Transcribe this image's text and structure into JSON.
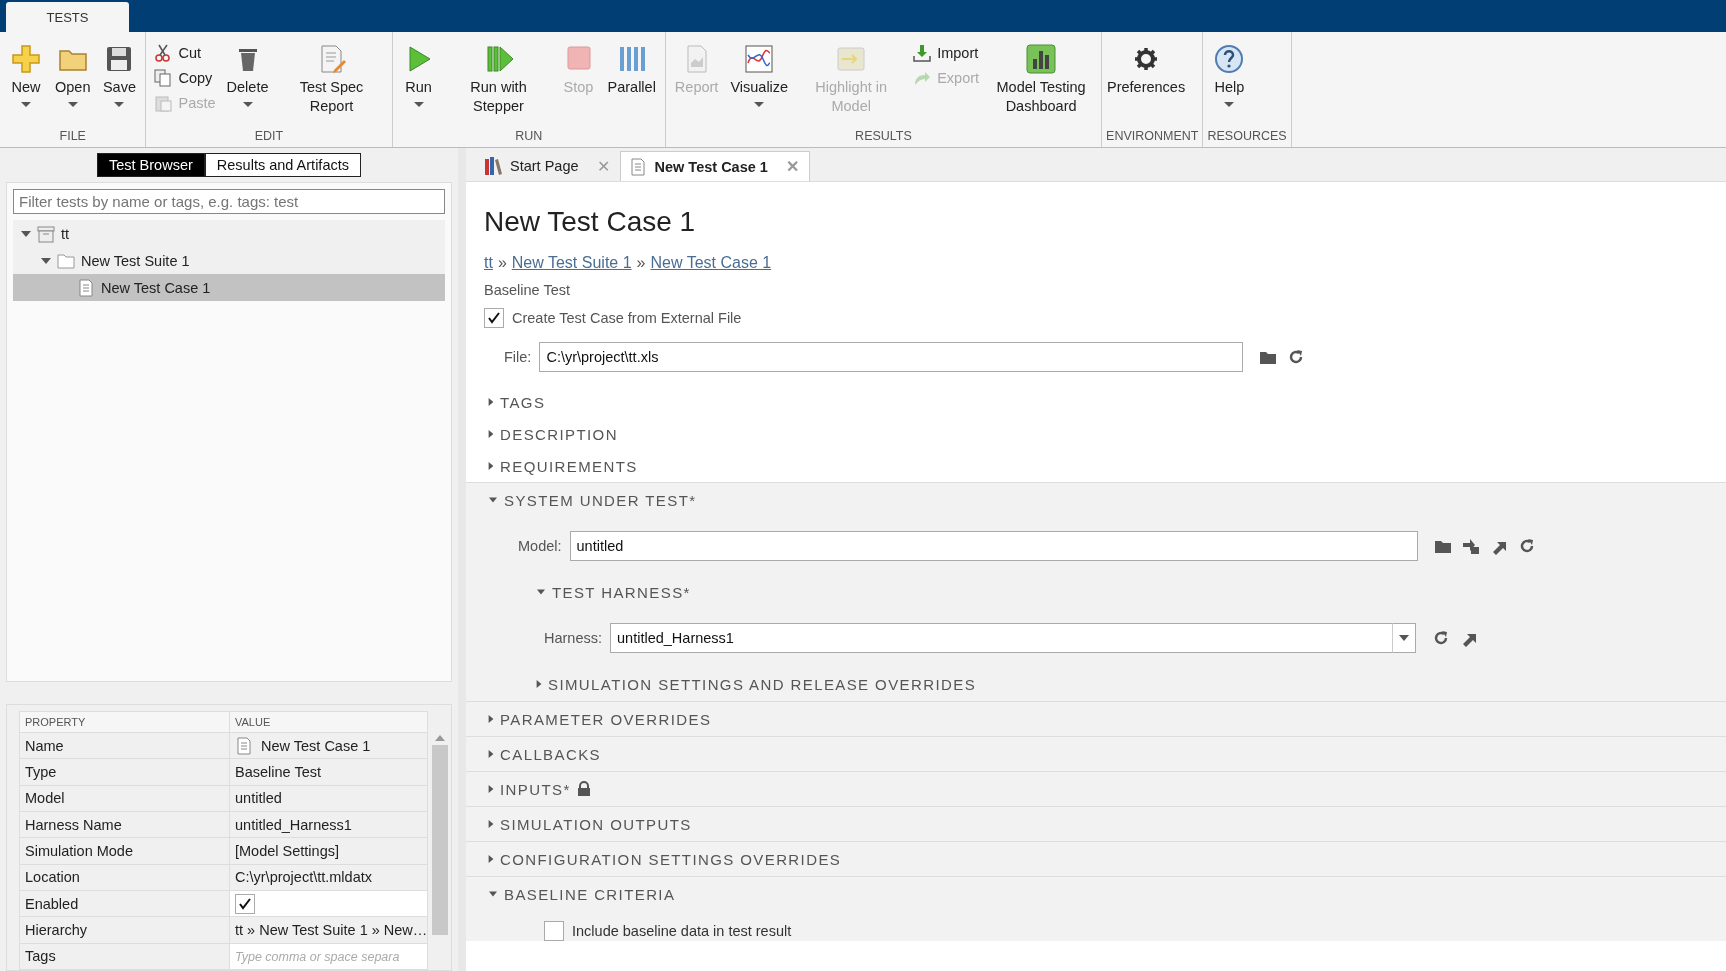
{
  "app_tab": {
    "label": "TESTS",
    "selected": true
  },
  "ribbon": [
    {
      "label": "FILE",
      "items": [
        {
          "kind": "large",
          "label": "New",
          "disabled": false,
          "dropdown": true
        },
        {
          "kind": "large",
          "label": "Open",
          "disabled": false,
          "dropdown": true
        },
        {
          "kind": "large",
          "label": "Save",
          "disabled": false,
          "dropdown": true
        }
      ]
    },
    {
      "label": "EDIT",
      "items": [
        {
          "kind": "stack",
          "items": [
            {
              "label": "Cut",
              "disabled": false
            },
            {
              "label": "Copy",
              "disabled": false
            },
            {
              "label": "Paste",
              "disabled": true
            }
          ]
        },
        {
          "kind": "large",
          "label": "Delete",
          "disabled": false,
          "dropdown": true
        },
        {
          "kind": "large",
          "label": "Test Spec Report",
          "disabled": false,
          "dropdown": false
        }
      ]
    },
    {
      "label": "RUN",
      "items": [
        {
          "kind": "large",
          "label": "Run",
          "disabled": false,
          "dropdown": true
        },
        {
          "kind": "large",
          "label": "Run with Stepper",
          "disabled": false,
          "dropdown": false
        },
        {
          "kind": "large",
          "label": "Stop",
          "disabled": true,
          "dropdown": false
        },
        {
          "kind": "large",
          "label": "Parallel",
          "disabled": false,
          "dropdown": false
        }
      ]
    },
    {
      "label": "RESULTS",
      "items": [
        {
          "kind": "large",
          "label": "Report",
          "disabled": true,
          "dropdown": false
        },
        {
          "kind": "large",
          "label": "Visualize",
          "disabled": false,
          "dropdown": true
        },
        {
          "kind": "large",
          "label": "Highlight in Model",
          "disabled": true,
          "dropdown": false
        },
        {
          "kind": "stack",
          "items": [
            {
              "label": "Import",
              "disabled": false
            },
            {
              "label": "Export",
              "disabled": true
            }
          ]
        },
        {
          "kind": "large",
          "label": "Model Testing Dashboard",
          "disabled": false,
          "dropdown": false
        }
      ]
    },
    {
      "label": "ENVIRONMENT",
      "items": [
        {
          "kind": "large",
          "label": "Preferences",
          "disabled": false,
          "dropdown": false
        }
      ]
    },
    {
      "label": "RESOURCES",
      "items": [
        {
          "kind": "large",
          "label": "Help",
          "disabled": false,
          "dropdown": true
        }
      ]
    }
  ],
  "browser_tabs": [
    {
      "label": "Test Browser",
      "selected": true
    },
    {
      "label": "Results and Artifacts",
      "selected": false
    }
  ],
  "filter": {
    "placeholder": "Filter tests by name or tags, e.g. tags: test"
  },
  "tree": [
    {
      "label": "tt",
      "kind": "file",
      "expanded": true,
      "selected": false,
      "children": [
        {
          "label": "New Test Suite 1",
          "kind": "suite",
          "expanded": true,
          "selected": false,
          "children": [
            {
              "label": "New Test Case 1",
              "kind": "case",
              "selected": true
            }
          ]
        }
      ]
    }
  ],
  "properties": {
    "columns": [
      "PROPERTY",
      "VALUE"
    ],
    "rows": [
      {
        "name": "Name",
        "value": "New Test Case 1",
        "kind": "icon"
      },
      {
        "name": "Type",
        "value": "Baseline Test",
        "kind": "text"
      },
      {
        "name": "Model",
        "value": "untitled",
        "kind": "text"
      },
      {
        "name": "Harness Name",
        "value": "untitled_Harness1",
        "kind": "text"
      },
      {
        "name": "Simulation Mode",
        "value": "[Model Settings]",
        "kind": "text"
      },
      {
        "name": "Location",
        "value": "C:\\yr\\project\\tt.mldatx",
        "kind": "text"
      },
      {
        "name": "Enabled",
        "checked": true,
        "kind": "checkbox"
      },
      {
        "name": "Hierarchy",
        "value": "tt » New Test Suite 1 » New…",
        "kind": "text"
      },
      {
        "name": "Tags",
        "placeholder": "Type comma or space separa",
        "kind": "field"
      }
    ]
  },
  "doc_tabs": [
    {
      "label": "Start Page",
      "selected": false,
      "close": "✕"
    },
    {
      "label": "New Test Case 1",
      "selected": true,
      "close": "✕"
    }
  ],
  "title": "New Test Case 1",
  "breadcrumb": {
    "separator": "»",
    "items": [
      "tt",
      "New Test Suite 1",
      "New Test Case 1"
    ]
  },
  "test_type": "Baseline Test",
  "external_file": {
    "label": "Create Test Case from External File",
    "checked": true
  },
  "file": {
    "label": "File:",
    "value": "C:\\yr\\project\\tt.xls"
  },
  "sections": [
    {
      "title": "TAGS",
      "expanded": false
    },
    {
      "title": "DESCRIPTION",
      "expanded": false
    },
    {
      "title": "REQUIREMENTS",
      "expanded": false
    }
  ],
  "panel_sections": [
    {
      "title": "SYSTEM UNDER TEST*",
      "expanded": true,
      "model": {
        "label": "Model:",
        "value": "untitled"
      },
      "subsections": [
        {
          "title": "TEST HARNESS*",
          "expanded": true,
          "harness": {
            "label": "Harness:",
            "value": "untitled_Harness1"
          }
        },
        {
          "title": "SIMULATION SETTINGS AND RELEASE OVERRIDES",
          "expanded": false
        }
      ]
    },
    {
      "title": "PARAMETER OVERRIDES",
      "expanded": false
    },
    {
      "title": "CALLBACKS",
      "expanded": false
    },
    {
      "title": "INPUTS*",
      "expanded": false,
      "locked": true
    },
    {
      "title": "SIMULATION OUTPUTS",
      "expanded": false
    },
    {
      "title": "CONFIGURATION SETTINGS OVERRIDES",
      "expanded": false
    },
    {
      "title": "BASELINE CRITERIA",
      "expanded": true,
      "checkbox": {
        "label": "Include baseline data in test result",
        "checked": false
      }
    }
  ]
}
